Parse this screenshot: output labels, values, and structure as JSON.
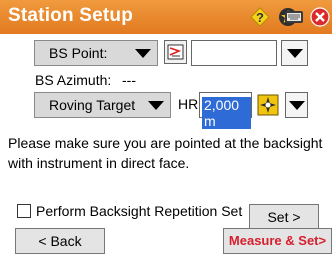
{
  "header": {
    "title": "Station Setup",
    "icons": [
      "help-icon",
      "favorites-star-icon",
      "keyboard-icon",
      "close-icon"
    ]
  },
  "backsight": {
    "point_label": "BS Point:",
    "point_value": "",
    "azimuth_label": "BS Azimuth:",
    "azimuth_value": "---"
  },
  "target": {
    "type": "Roving Target",
    "hr_label": "HR",
    "hr_value": "2,000 m"
  },
  "message": "Please make sure you are pointed at the backsight with instrument in direct face.",
  "options": {
    "repetition_label": "Perform Backsight Repetition Set",
    "repetition_checked": false
  },
  "buttons": {
    "set": "Set >",
    "back": "< Back",
    "measure_set": "Measure & Set>"
  },
  "colors": {
    "titlebar": "#e8832a",
    "measure_text": "#d6202e",
    "selection": "#2f6bd6"
  }
}
